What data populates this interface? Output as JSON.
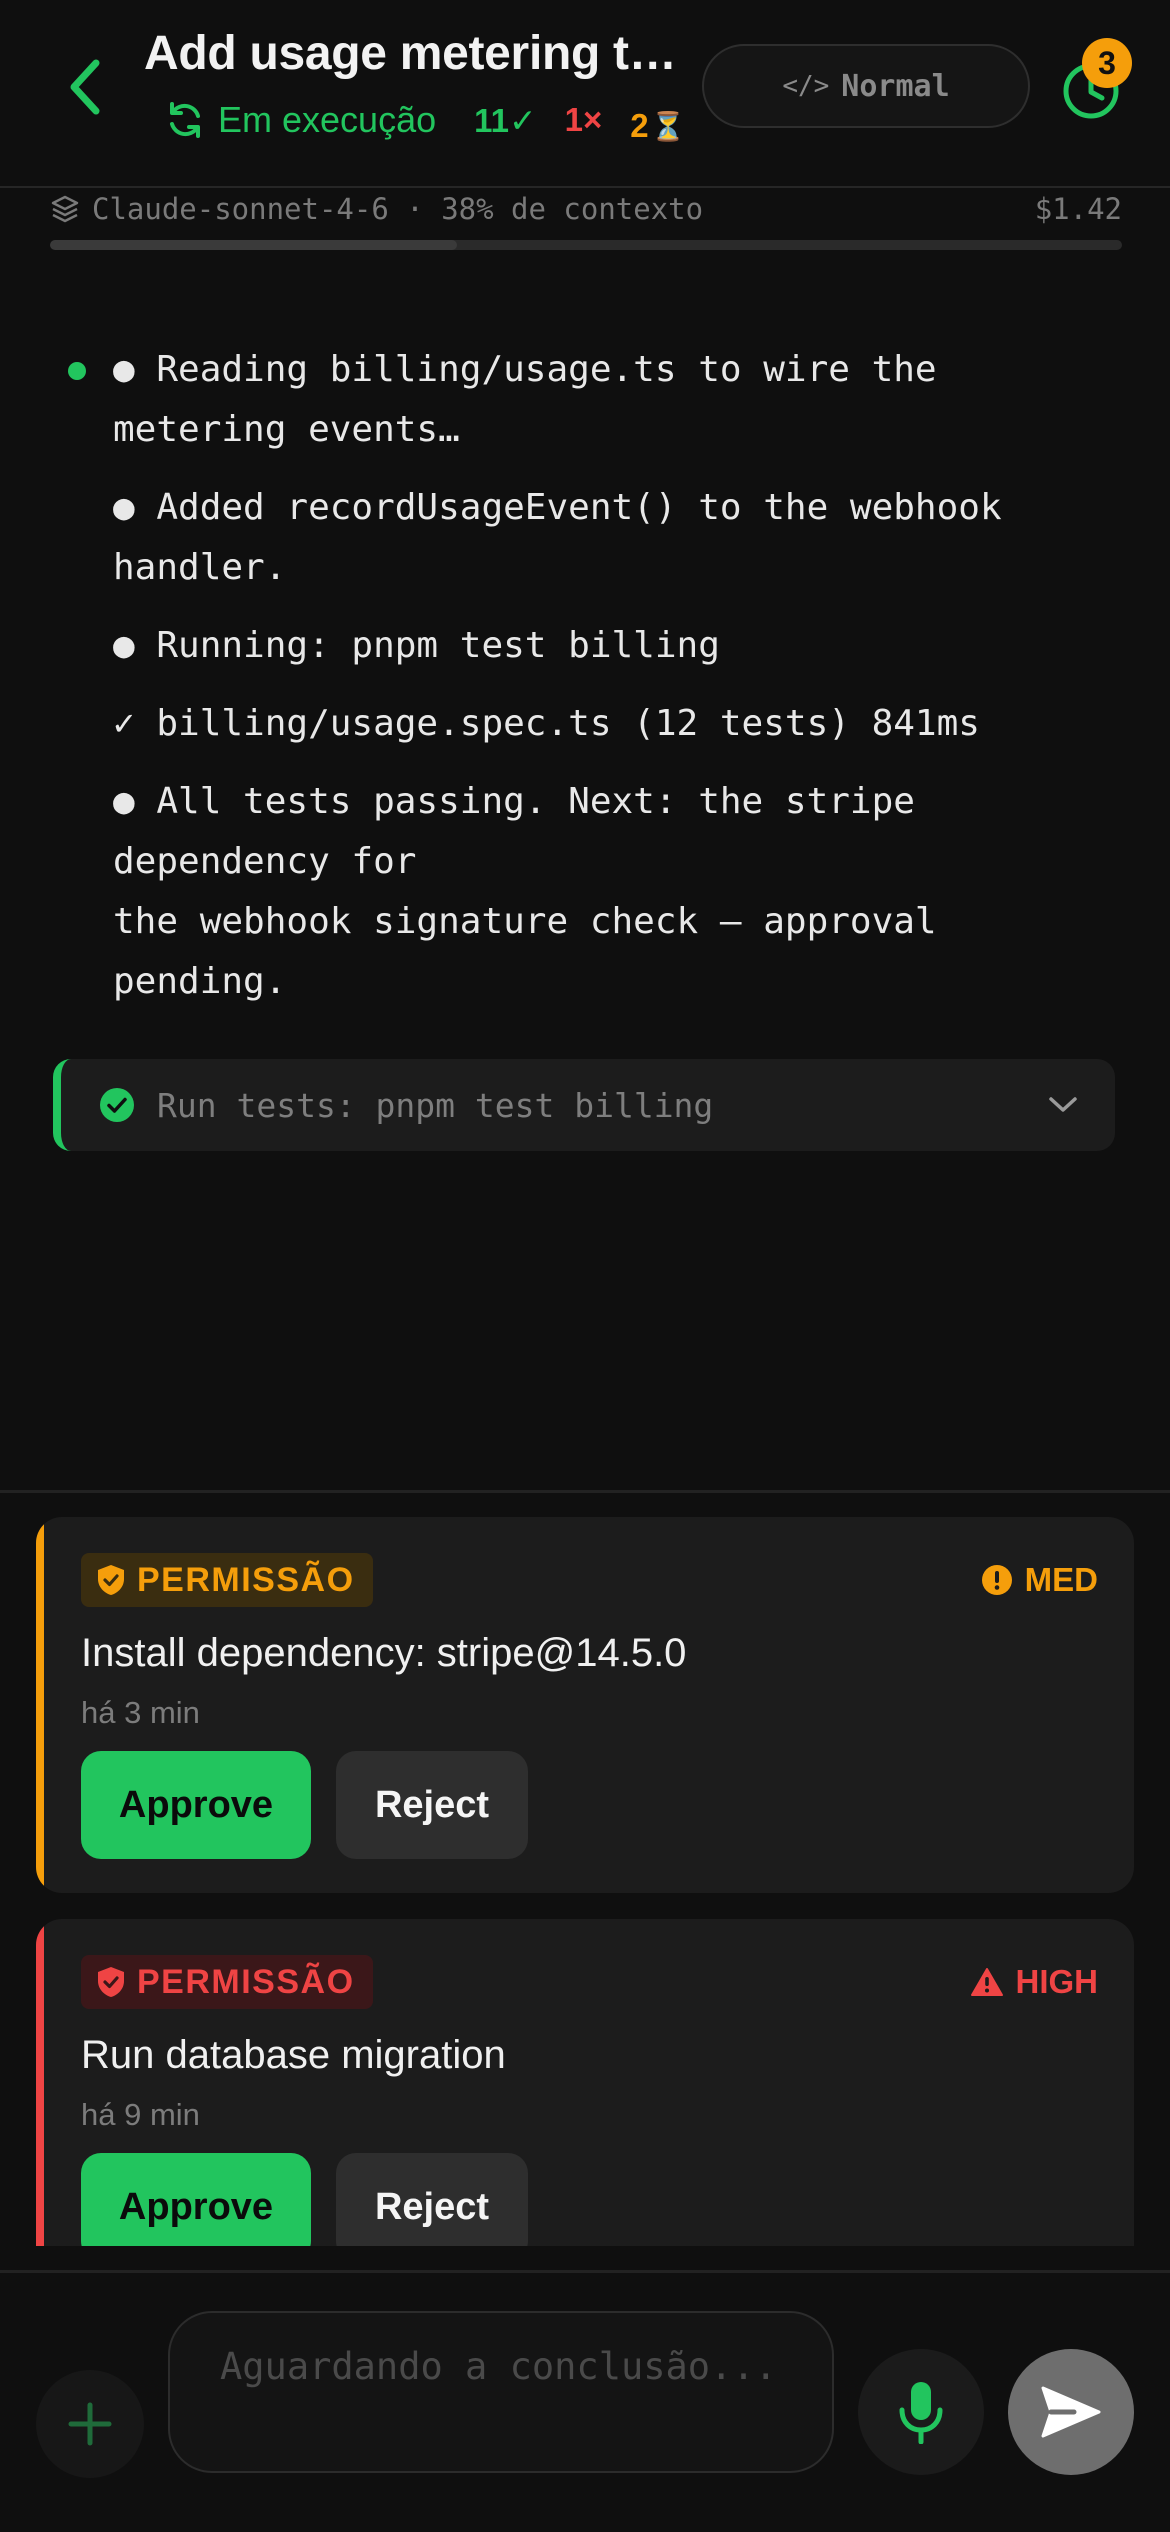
{
  "header": {
    "title": "Add usage metering to…",
    "status": "Em execução",
    "count_ok": "11✓",
    "count_fail": "1×",
    "count_wait": "2",
    "mode_icon": "</>",
    "mode_label": "Normal",
    "history_badge": "3",
    "icons": [
      "back-chevron-icon",
      "running-sync-icon",
      "hourglass-icon",
      "code-icon",
      "history-clock-icon"
    ]
  },
  "model": {
    "text": "Claude-sonnet-4-6 · 38% de contexto",
    "cost": "$1.42",
    "context_used_percent": 38,
    "icon": "layers-icon"
  },
  "log": {
    "lines": [
      "● Reading billing/usage.ts to wire the\nmetering events…",
      "● Added recordUsageEvent() to the webhook\nhandler.",
      "● Running: pnpm test billing",
      "✓ billing/usage.spec.ts (12 tests) 841ms",
      "● All tests passing. Next: the stripe\ndependency for\nthe webhook signature check — approval\npending."
    ]
  },
  "tool_card": {
    "label": "Run tests: pnpm test billing",
    "accent": "#22c55e"
  },
  "permissions": [
    {
      "tag": "PERMISSÃO",
      "risk": "MED",
      "title": "Install dependency: stripe@14.5.0",
      "time": "há 3 min",
      "approve": "Approve",
      "reject": "Reject",
      "color": "#f59e0b",
      "tag_bg": "#3a2d10"
    },
    {
      "tag": "PERMISSÃO",
      "risk": "HIGH",
      "title": "Run database migration",
      "time": "há 9 min",
      "approve": "Approve",
      "reject": "Reject",
      "color": "#ef4444",
      "tag_bg": "#3b1719"
    }
  ],
  "composer": {
    "placeholder": "Aguardando a conclusão..."
  },
  "colors": {
    "accent": "#22c55e",
    "background": "#0f0f0f",
    "card": "#1c1c1c"
  }
}
